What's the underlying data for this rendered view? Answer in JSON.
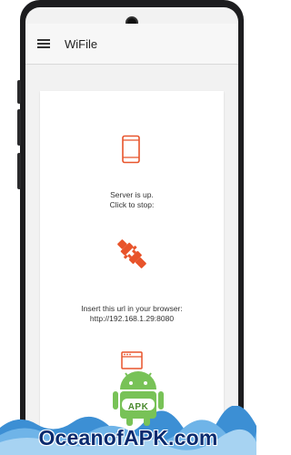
{
  "app": {
    "title": "WiFile"
  },
  "server": {
    "status_line1": "Server is up.",
    "status_line2": "Click to stop:",
    "url_line1": "Insert this url in your browser:",
    "url_line2": "http://192.168.1.29:8080"
  },
  "icons": {
    "menu": "menu-icon",
    "phone": "smartphone-icon",
    "plug": "plug-icon",
    "browser": "browser-window-icon"
  },
  "colors": {
    "accent": "#e8542b",
    "appbar": "#f7f7f7",
    "background": "#f2f2f2"
  },
  "watermark": {
    "text": "OceanofAPK.com",
    "badge": "APK"
  }
}
